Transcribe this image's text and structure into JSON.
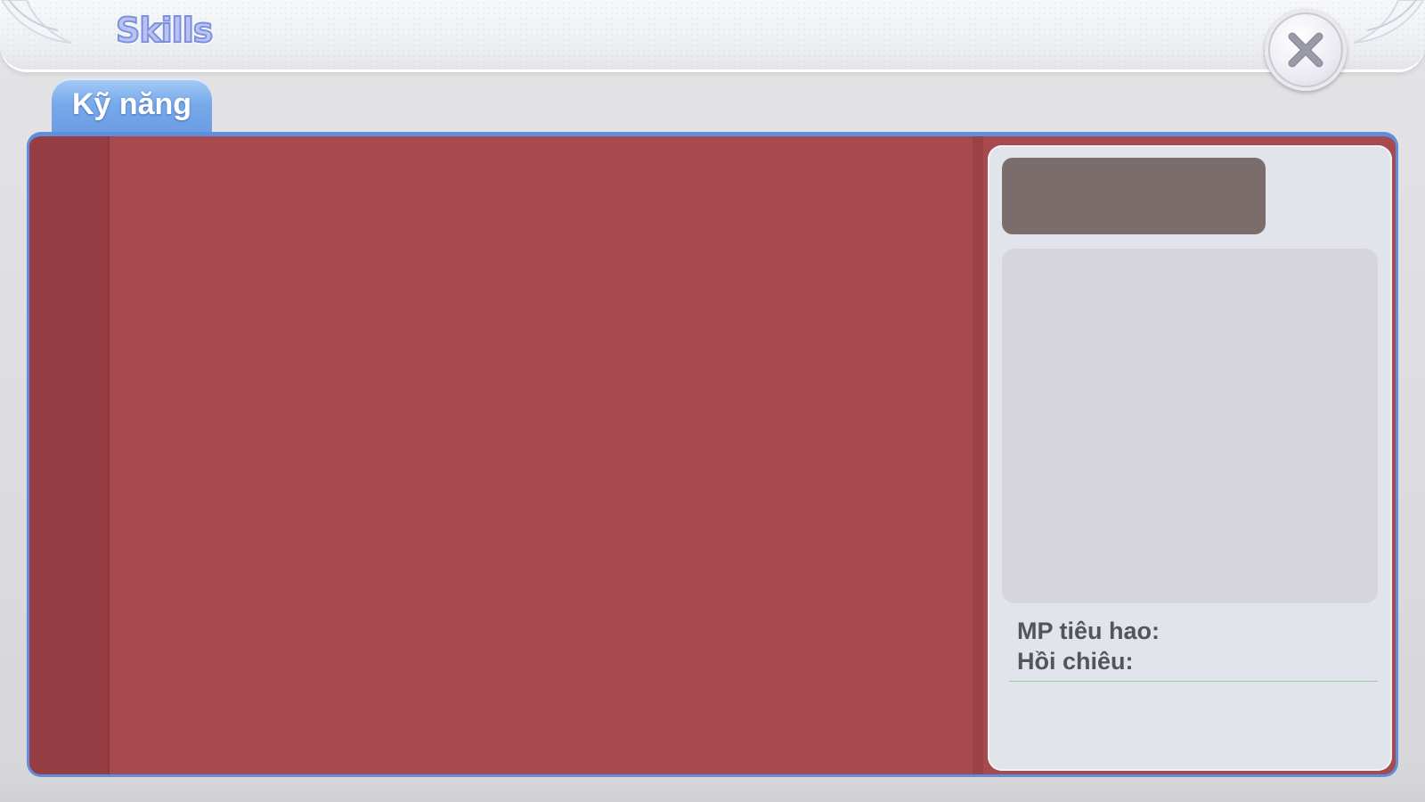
{
  "header": {
    "title": "Skills",
    "close_icon": "close-icon"
  },
  "tabs": [
    {
      "label": "Kỹ năng",
      "active": true
    }
  ],
  "detail": {
    "mp_cost_label": "MP tiêu hao:",
    "cooldown_label": "Hồi chiêu:"
  },
  "colors": {
    "panel_bg": "#a64a4e",
    "sidebar_bg": "#953d42",
    "tab_accent": "#77a9ea",
    "panel_border": "#5f8fdc",
    "detail_card_bg": "#e2e4ec",
    "name_box_bg": "#7a6d6c",
    "desc_box_bg": "#d7d5dc",
    "stat_text": "#54545c"
  }
}
